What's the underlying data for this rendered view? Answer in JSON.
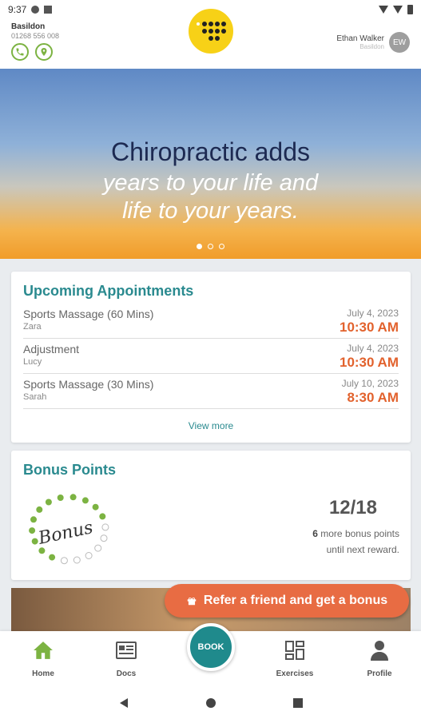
{
  "status_bar": {
    "time": "9:37"
  },
  "header": {
    "clinic_name": "Basildon",
    "clinic_phone": "01268 556 008",
    "user_name": "Ethan Walker",
    "user_location": "Basildon",
    "avatar_initials": "EW"
  },
  "hero": {
    "line1": "Chiropractic adds",
    "line2": "years to your life and",
    "line3": "life to your years."
  },
  "appointments": {
    "title": "Upcoming Appointments",
    "items": [
      {
        "service": "Sports Massage (60 Mins)",
        "staff": "Zara",
        "date": "July 4, 2023",
        "time": "10:30 AM"
      },
      {
        "service": "Adjustment",
        "staff": "Lucy",
        "date": "July 4, 2023",
        "time": "10:30 AM"
      },
      {
        "service": "Sports Massage (30 Mins)",
        "staff": "Sarah",
        "date": "July 10, 2023",
        "time": "8:30 AM"
      }
    ],
    "view_more": "View more"
  },
  "bonus": {
    "title": "Bonus Points",
    "ring_label": "Bonus",
    "count": "12/18",
    "remaining": "6",
    "message_part1": "more bonus points",
    "message_part2": "until next reward.",
    "earned": 12,
    "total": 18
  },
  "promo": {
    "refer_label": "Refer a friend and get a bonus"
  },
  "nav": {
    "home": "Home",
    "docs": "Docs",
    "book": "BOOK",
    "exercises": "Exercises",
    "profile": "Profile"
  },
  "colors": {
    "teal": "#2a8a8f",
    "orange": "#e2622d",
    "green": "#7cb342",
    "yellow": "#f7d117"
  }
}
